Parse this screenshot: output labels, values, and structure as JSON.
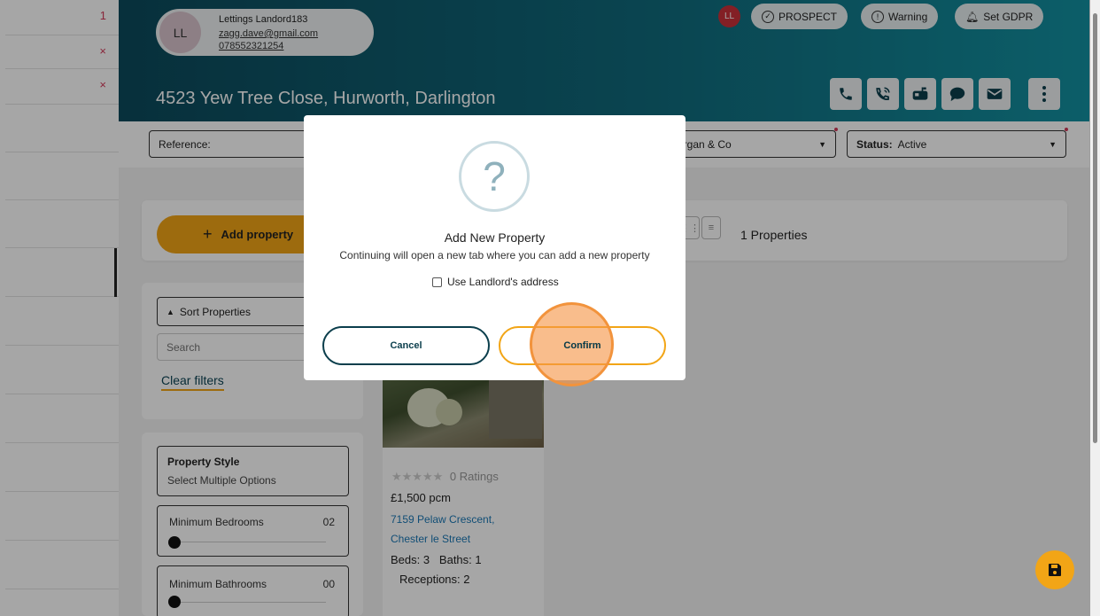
{
  "sidebar": {
    "marks": [
      "1",
      "×",
      "×"
    ]
  },
  "contact": {
    "initials": "LL",
    "name": "Lettings Landord183",
    "email": "zagg.dave@gmail.com",
    "phone": "078552321254"
  },
  "header": {
    "address": "4523 Yew Tree Close, Hurworth, Darlington",
    "user_initials": "LL",
    "prospect_label": "PROSPECT",
    "warning_label": "Warning",
    "gdpr_label": "Set GDPR",
    "actions": [
      "phone-icon",
      "phone-call-icon",
      "mailbox-icon",
      "chat-icon",
      "mail-icon",
      "more-vertical-icon"
    ]
  },
  "filters": {
    "reference_label": "Reference:",
    "agency_value": "organ & Co",
    "status_label": "Status:",
    "status_value": "Active"
  },
  "toolbar": {
    "add_property_label": "Add property",
    "properties_count": "1 Properties"
  },
  "sidepanel": {
    "sort_label": "Sort Properties",
    "search_placeholder": "Search",
    "clear_filters_label": "Clear filters",
    "property_style_label": "Property Style",
    "property_style_value": "Select Multiple Options",
    "min_bedrooms_label": "Minimum Bedrooms",
    "min_bedrooms_value": "02",
    "min_bathrooms_label": "Minimum Bathrooms",
    "min_bathrooms_value": "00"
  },
  "property_card": {
    "stars": "★★★★★",
    "ratings": "0 Ratings",
    "price": "£1,500 pcm",
    "address_line1": "7159 Pelaw Crescent,",
    "address_line2": "Chester le Street",
    "beds_baths": "Beds: 3   Baths: 1",
    "receptions": "Receptions: 2"
  },
  "modal": {
    "icon": "?",
    "title": "Add New Property",
    "text": "Continuing will open a new tab where you can add a new property",
    "checkbox_label": "Use Landlord's address",
    "checkbox_checked": false,
    "cancel_label": "Cancel",
    "confirm_label": "Confirm"
  },
  "colors": {
    "accent": "#f2a516",
    "header_dark": "#0c4a5c",
    "header_light": "#1391a1",
    "danger": "#d33a5a",
    "click_highlight": "#f2933c"
  }
}
